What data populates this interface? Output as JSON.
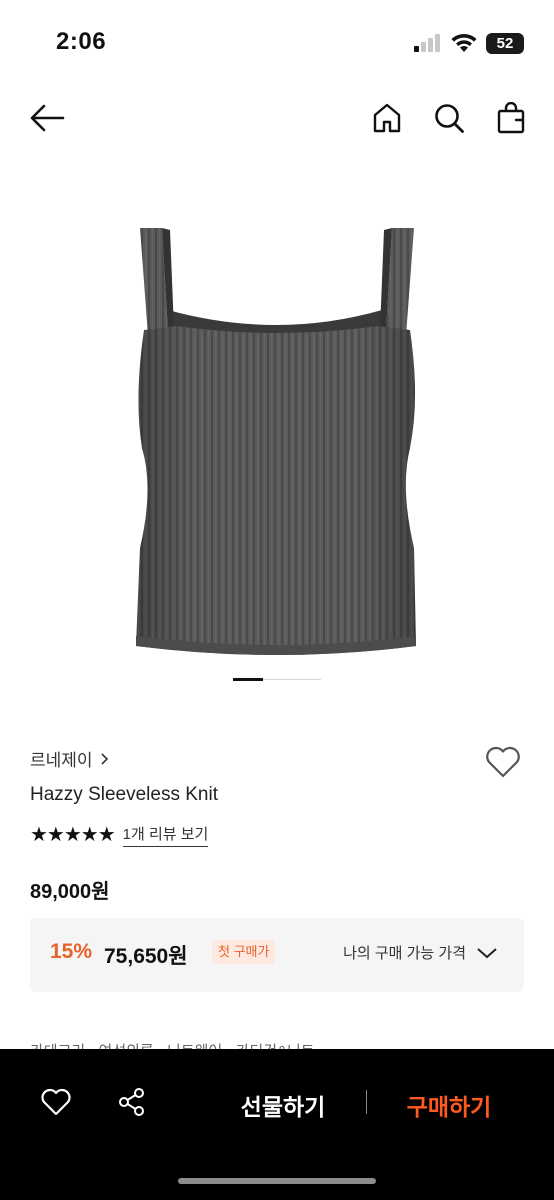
{
  "status": {
    "time": "2:06",
    "battery": "52"
  },
  "product": {
    "brand": "르네제이",
    "name": "Hazzy Sleeveless Knit",
    "stars": "★★★★★",
    "review_link": "1개 리뷰 보기",
    "price": "89,000원",
    "discount": {
      "percent": "15%",
      "price": "75,650원",
      "badge": "첫 구매가",
      "my_price_label": "나의 구매 가능 가격"
    },
    "breadcrumb": "카테고리  ›  여성의류  ›  니트웨어  ›  카디건&니트"
  },
  "bottom_bar": {
    "gift_label": "선물하기",
    "buy_label": "구매하기"
  },
  "colors": {
    "accent": "#e8622a",
    "buy": "#ff5a1f"
  }
}
